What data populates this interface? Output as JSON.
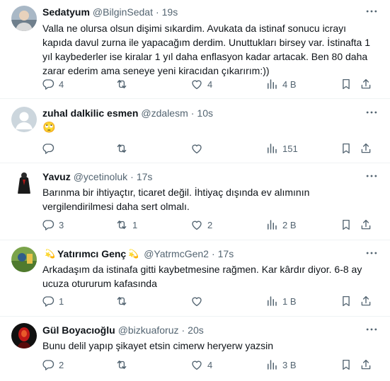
{
  "tweets": [
    {
      "name": "Sedatyum",
      "handle": "@BilginSedat",
      "time": "19s",
      "text": "Valla ne olursa olsun dişimi sıkardim. Avukata da istinaf sonucu icrayı\nkapıda davul zurna ile yapacağım derdim. Unuttukları birsey var. İstinafta 1\nyıl kaybederler ise kiralar 1 yıl daha enflasyon kadar artacak. Ben 80 daha\nzarar ederim ama seneye yeni kiracıdan çıkarırım:))",
      "replies": "4",
      "reposts": "",
      "likes": "4",
      "views": "4 B"
    },
    {
      "name": "zuhal dalkilic esmen",
      "handle": "@zdalesm",
      "time": "10s",
      "text": "🙄",
      "replies": "",
      "reposts": "",
      "likes": "",
      "views": "151"
    },
    {
      "name": "Yavuz",
      "handle": "@ycetinoluk",
      "time": "17s",
      "text": "Barınma bir ihtiyaçtır, ticaret değil. İhtiyaç dışında ev alımının\nvergilendirilmesi daha sert olmalı.",
      "replies": "3",
      "reposts": "1",
      "likes": "2",
      "views": "2 B"
    },
    {
      "name": "Yatırımcı Genç",
      "handle": "@YatrmcGen2",
      "time": "17s",
      "text": "Arkadaşım da istinafa gitti kaybetmesine rağmen. Kar kârdır diyor. 6-8 ay\nucuza otururum kafasında",
      "replies": "1",
      "reposts": "",
      "likes": "",
      "views": "1 B"
    },
    {
      "name": "Gül Boyacıoğlu",
      "handle": "@bizkuaforuz",
      "time": "20s",
      "text": "Bunu delil yapıp şikayet etsin cimerw heryerw yazsin",
      "replies": "2",
      "reposts": "",
      "likes": "4",
      "views": "3 B"
    }
  ],
  "separator": "·",
  "name_badge": "💫",
  "icons": [
    "more-icon",
    "reply-icon",
    "repost-icon",
    "like-icon",
    "views-icon",
    "bookmark-icon",
    "share-icon"
  ],
  "colors": {
    "text": "#0f1419",
    "secondary": "#536471",
    "border": "#eff3f4"
  }
}
